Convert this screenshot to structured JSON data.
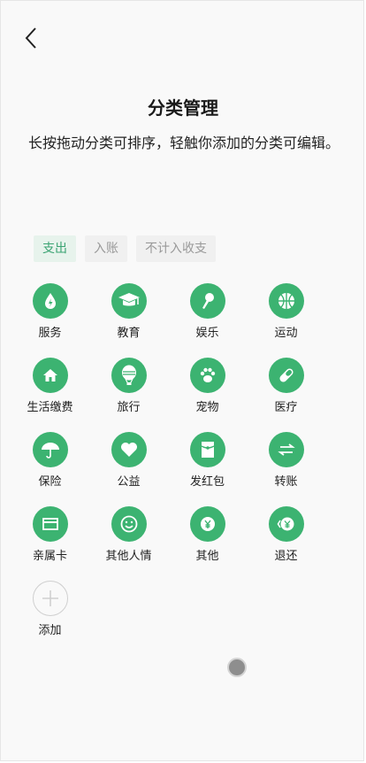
{
  "header": {
    "title": "分类管理",
    "back": "back"
  },
  "description": "长按拖动分类可排序，轻触你添加的分类可编辑。",
  "tabs": [
    {
      "label": "支出",
      "active": true
    },
    {
      "label": "入账",
      "active": false
    },
    {
      "label": "不计入收支",
      "active": false
    }
  ],
  "categories": [
    {
      "label": "服务",
      "icon": "water-drop-bolt-icon"
    },
    {
      "label": "教育",
      "icon": "graduation-cap-icon"
    },
    {
      "label": "娱乐",
      "icon": "microphone-icon"
    },
    {
      "label": "运动",
      "icon": "basketball-icon"
    },
    {
      "label": "生活缴费",
      "icon": "home-icon"
    },
    {
      "label": "旅行",
      "icon": "hot-air-balloon-icon"
    },
    {
      "label": "宠物",
      "icon": "paw-icon"
    },
    {
      "label": "医疗",
      "icon": "pill-icon"
    },
    {
      "label": "保险",
      "icon": "umbrella-icon"
    },
    {
      "label": "公益",
      "icon": "heart-icon"
    },
    {
      "label": "发红包",
      "icon": "red-envelope-icon"
    },
    {
      "label": "转账",
      "icon": "transfer-arrows-icon"
    },
    {
      "label": "亲属卡",
      "icon": "card-icon"
    },
    {
      "label": "其他人情",
      "icon": "smile-icon"
    },
    {
      "label": "其他",
      "icon": "yen-icon"
    },
    {
      "label": "退还",
      "icon": "refund-yen-icon"
    }
  ],
  "add": {
    "label": "添加",
    "icon": "plus-icon"
  },
  "colors": {
    "accent": "#3cb371",
    "tab_active_text": "#3aa372"
  }
}
